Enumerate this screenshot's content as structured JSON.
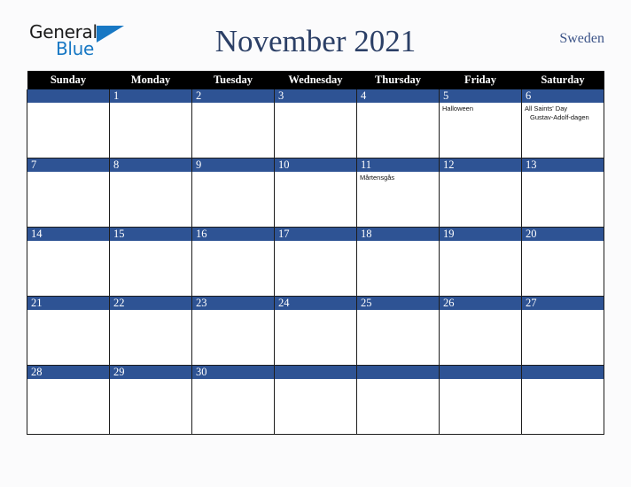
{
  "brand": {
    "word1": "General",
    "word2": "Blue",
    "flag_color": "#1878c4"
  },
  "header": {
    "title": "November 2021",
    "country": "Sweden",
    "title_color": "#2b3f66",
    "country_color": "#3c5488"
  },
  "calendar": {
    "accent_color": "#2e5394",
    "header_bg": "#000000",
    "weekday_headers": [
      "Sunday",
      "Monday",
      "Tuesday",
      "Wednesday",
      "Thursday",
      "Friday",
      "Saturday"
    ],
    "weeks": [
      [
        {
          "date": "",
          "events": []
        },
        {
          "date": "1",
          "events": []
        },
        {
          "date": "2",
          "events": []
        },
        {
          "date": "3",
          "events": []
        },
        {
          "date": "4",
          "events": []
        },
        {
          "date": "5",
          "events": [
            {
              "text": "Halloween",
              "indent": false
            }
          ]
        },
        {
          "date": "6",
          "events": [
            {
              "text": "All Saints' Day",
              "indent": false
            },
            {
              "text": "Gustav-Adolf-dagen",
              "indent": true
            }
          ]
        }
      ],
      [
        {
          "date": "7",
          "events": []
        },
        {
          "date": "8",
          "events": []
        },
        {
          "date": "9",
          "events": []
        },
        {
          "date": "10",
          "events": []
        },
        {
          "date": "11",
          "events": [
            {
              "text": "Mårtensgås",
              "indent": false
            }
          ]
        },
        {
          "date": "12",
          "events": []
        },
        {
          "date": "13",
          "events": []
        }
      ],
      [
        {
          "date": "14",
          "events": []
        },
        {
          "date": "15",
          "events": []
        },
        {
          "date": "16",
          "events": []
        },
        {
          "date": "17",
          "events": []
        },
        {
          "date": "18",
          "events": []
        },
        {
          "date": "19",
          "events": []
        },
        {
          "date": "20",
          "events": []
        }
      ],
      [
        {
          "date": "21",
          "events": []
        },
        {
          "date": "22",
          "events": []
        },
        {
          "date": "23",
          "events": []
        },
        {
          "date": "24",
          "events": []
        },
        {
          "date": "25",
          "events": []
        },
        {
          "date": "26",
          "events": []
        },
        {
          "date": "27",
          "events": []
        }
      ],
      [
        {
          "date": "28",
          "events": []
        },
        {
          "date": "29",
          "events": []
        },
        {
          "date": "30",
          "events": []
        },
        {
          "date": "",
          "events": []
        },
        {
          "date": "",
          "events": []
        },
        {
          "date": "",
          "events": []
        },
        {
          "date": "",
          "events": []
        }
      ]
    ]
  }
}
